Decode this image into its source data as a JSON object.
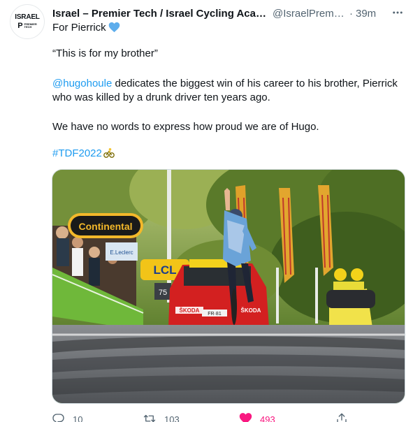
{
  "account": {
    "name": "Israel – Premier Tech / Israel Cycling Acad...",
    "handle": "@IsraelPremT...",
    "separator": "·",
    "time": "39m",
    "avatar_logo_top": "ISRAEL",
    "avatar_logo_bottom_1": "PREMIER",
    "avatar_logo_bottom_2": "TECH"
  },
  "tweet": {
    "line1": "For Pierrick",
    "line2": "“This is for my brother”",
    "mention": "@hugohoule",
    "line3_rest": " dedicates the biggest win of his career to his brother, Pierrick who was killed by a drunk driver ten years ago.",
    "line4": "We have no words to express how proud we are of Hugo.",
    "hashtag": "#TDF2022"
  },
  "media_text": {
    "banner": "Continental",
    "sign_lcl": "LCL",
    "sign_leclerc": "E.Leclerc",
    "car_brand_left": "ŠKODA",
    "car_brand_right": "ŠKODA",
    "plate": "FR·81",
    "sign_75": "75"
  },
  "actions": {
    "reply_count": "10",
    "retweet_count": "103",
    "like_count": "493"
  },
  "colors": {
    "link": "#1d9bf0",
    "like": "#f91880",
    "muted": "#536471"
  },
  "icons": [
    "blue-heart-icon",
    "cyclist-icon",
    "more-icon",
    "reply-icon",
    "retweet-icon",
    "heart-icon",
    "share-icon"
  ]
}
